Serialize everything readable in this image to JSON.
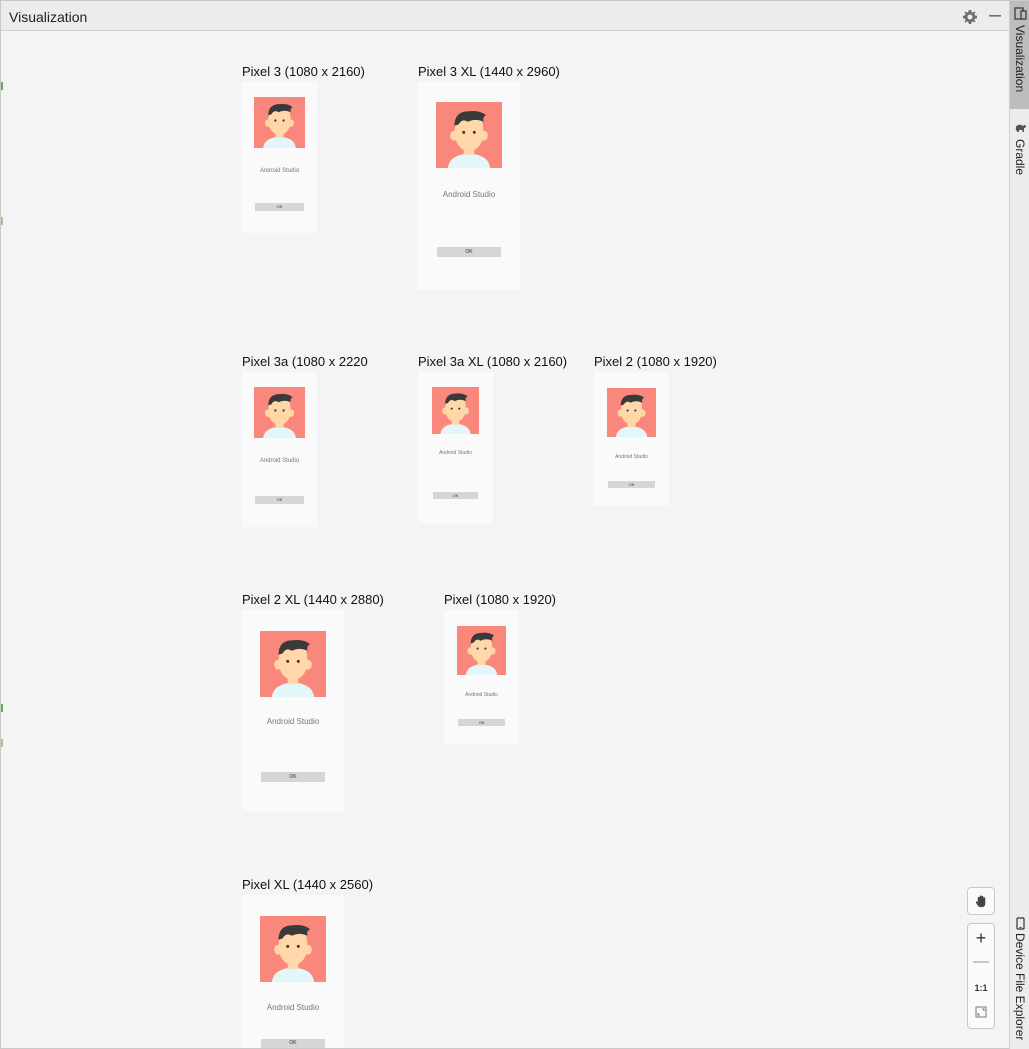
{
  "window": {
    "title": "Visualization"
  },
  "toolbar": {
    "settings_icon": "gear-icon",
    "minimize_icon": "minimize-icon"
  },
  "side_tabs": [
    {
      "label": "Visualization",
      "icon": "device-icon",
      "active": true
    },
    {
      "label": "Gradle",
      "icon": "elephant-icon",
      "active": false
    },
    {
      "label": "Device File Explorer",
      "icon": "phone-icon",
      "active": false
    }
  ],
  "preview": {
    "app_name": "Android Studio",
    "button_label": "OK",
    "colors": {
      "avatar_bg": "#fa877c",
      "skin": "#ffd7a8",
      "hair": "#3a3a3a",
      "shirt": "#e3f6f9",
      "button_bg": "#d6d6d6"
    },
    "devices": [
      {
        "label": "Pixel 3 (1080 x 2160)"
      },
      {
        "label": "Pixel 3 XL (1440 x 2960)"
      },
      {
        "label": "Pixel 3a (1080 x 2220)"
      },
      {
        "label": "Pixel 3a XL (1080 x 2160)"
      },
      {
        "label": "Pixel 2 (1080 x 1920)"
      },
      {
        "label": "Pixel 2 XL (1440 x 2880)"
      },
      {
        "label": "Pixel (1080 x 1920)"
      },
      {
        "label": "Pixel XL (1440 x 2560)"
      }
    ]
  },
  "zoom_controls": {
    "zoom_in": "+",
    "zoom_out": "—",
    "actual_size": "1:1",
    "pan_icon": "hand-icon",
    "fit_icon": "fit-screen-icon"
  }
}
